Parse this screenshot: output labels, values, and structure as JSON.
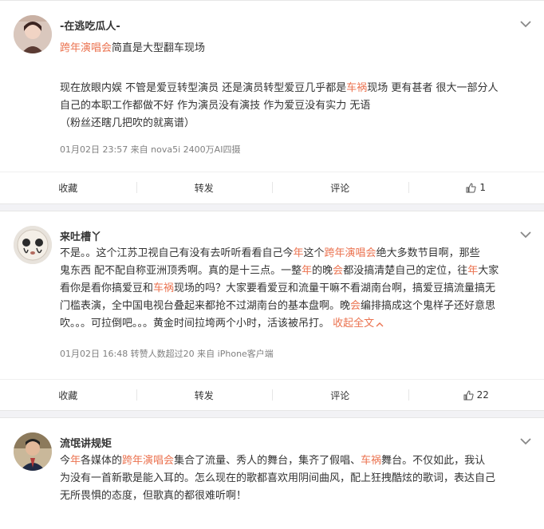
{
  "comments": [
    {
      "username": "-在逃吃瓜人-",
      "title_parts": [
        {
          "text": "跨年演唱会",
          "hl": true
        },
        {
          "text": "简直是大型翻车现场",
          "hl": false
        }
      ],
      "lines": [
        [
          {
            "text": "现在放眼内娱 不管是爱豆转型演员 还是演员转型爱豆几乎都是",
            "hl": false
          },
          {
            "text": "车祸",
            "hl": true
          },
          {
            "text": "现场 更有甚者 很大一部分人",
            "hl": false
          }
        ],
        [
          {
            "text": "自己的本职工作都做不好 作为演员没有演技 作为爱豆没有实力 无语",
            "hl": false
          }
        ],
        [
          {
            "text": "（粉丝还瞎几把吹的就离谱）",
            "hl": false
          }
        ]
      ],
      "meta": "01月02日 23:57  来自 nova5i 2400万AI四摄",
      "actions": {
        "collect": "收藏",
        "repost": "转发",
        "comment": "评论",
        "like_count": "1"
      }
    },
    {
      "username": "来吐槽丫",
      "lines": [
        [
          {
            "text": "不是。。这个江苏卫视自己有没有去听听看看自己今",
            "hl": false
          },
          {
            "text": "年",
            "hl": true
          },
          {
            "text": "这个",
            "hl": false
          },
          {
            "text": "跨年演唱会",
            "hl": true
          },
          {
            "text": "绝大多数节目啊，那些",
            "hl": false
          }
        ],
        [
          {
            "text": "鬼东西 配不配自称亚洲顶秀啊。真的是十三点。一整",
            "hl": false
          },
          {
            "text": "年",
            "hl": true
          },
          {
            "text": "的晚",
            "hl": false
          },
          {
            "text": "会",
            "hl": true
          },
          {
            "text": "都没搞清楚自己的定位，往",
            "hl": false
          },
          {
            "text": "年",
            "hl": true
          },
          {
            "text": "大家",
            "hl": false
          }
        ],
        [
          {
            "text": "看你是看你搞爱豆和",
            "hl": false
          },
          {
            "text": "车祸",
            "hl": true
          },
          {
            "text": "现场的吗？大家要看爱豆和流量干嘛不看湖南台啊，搞爱豆搞流量搞无",
            "hl": false
          }
        ],
        [
          {
            "text": "门槛表演，全中国电视台叠起来都抢不过湖南台的基本盘啊。晚",
            "hl": false
          },
          {
            "text": "会",
            "hl": true
          },
          {
            "text": "编排搞成这个鬼样子还好意思",
            "hl": false
          }
        ],
        [
          {
            "text": "吹。。。可拉倒吧。。。黄金时间拉垮两个小时，活该被吊打。",
            "hl": false
          }
        ]
      ],
      "collapse_label": "收起全文",
      "meta": "01月02日 16:48 转赞人数超过20  来自 iPhone客户端",
      "actions": {
        "collect": "收藏",
        "repost": "转发",
        "comment": "评论",
        "like_count": "22"
      }
    },
    {
      "username": "流氓讲规矩",
      "lines": [
        [
          {
            "text": "今",
            "hl": false
          },
          {
            "text": "年",
            "hl": true
          },
          {
            "text": "各媒体的",
            "hl": false
          },
          {
            "text": "跨年演唱会",
            "hl": true
          },
          {
            "text": "集合了流量、秀人的舞台，集齐了假唱、",
            "hl": false
          },
          {
            "text": "车祸",
            "hl": true
          },
          {
            "text": "舞台。不仅如此，我认",
            "hl": false
          }
        ],
        [
          {
            "text": "为没有一首新歌是能入耳的。怎么现在的歌都喜欢用阴间曲风，配上狂拽酷炫的歌词，表达自己",
            "hl": false
          }
        ],
        [
          {
            "text": "无所畏惧的态度，但歌真的都很难听啊！",
            "hl": false
          }
        ]
      ]
    }
  ],
  "colors": {
    "highlight": "#eb7350",
    "meta": "#808080",
    "background": "#f2f2f5"
  }
}
